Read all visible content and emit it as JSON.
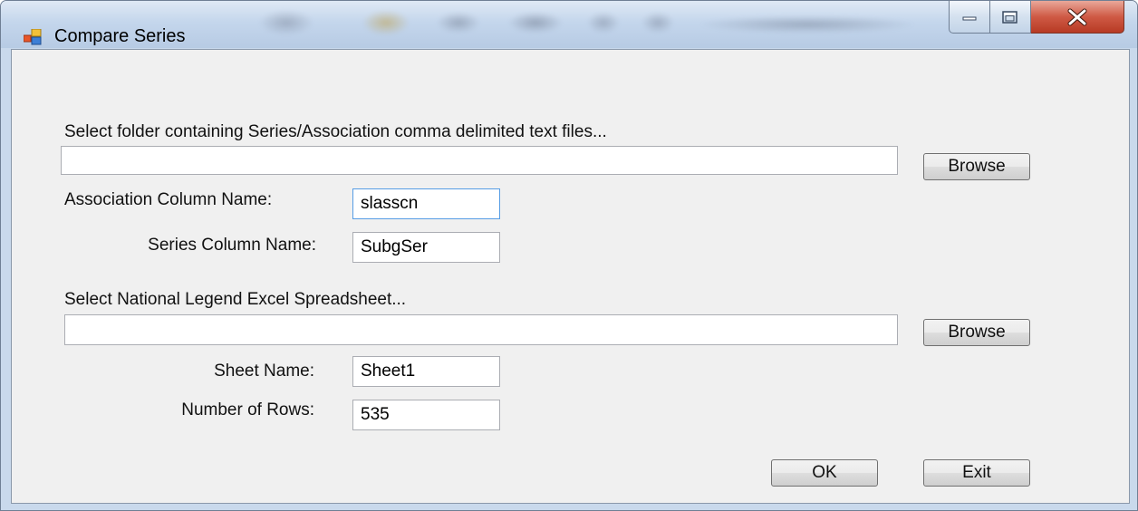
{
  "window": {
    "title": "Compare Series",
    "controls": {
      "minimize": "minimize",
      "maximize": "maximize",
      "close": "close"
    }
  },
  "form": {
    "folder_prompt": "Select folder containing Series/Association comma delimited text files...",
    "folder_path": {
      "value": ""
    },
    "browse_folder_label": "Browse",
    "association_label": "Association Column Name:",
    "association_value": "slasscn",
    "series_label": "Series Column Name:",
    "series_value": "SubgSer",
    "legend_prompt": "Select National Legend Excel Spreadsheet...",
    "legend_path": {
      "value": ""
    },
    "browse_legend_label": "Browse",
    "sheet_label": "Sheet Name:",
    "sheet_value": "Sheet1",
    "rows_label": "Number of Rows:",
    "rows_value": "535",
    "ok_label": "OK",
    "exit_label": "Exit"
  },
  "colors": {
    "frame": "#c9d9ec",
    "client_background": "#f0f0f0",
    "close_button": "#c7503b",
    "focus_border": "#569de5"
  }
}
